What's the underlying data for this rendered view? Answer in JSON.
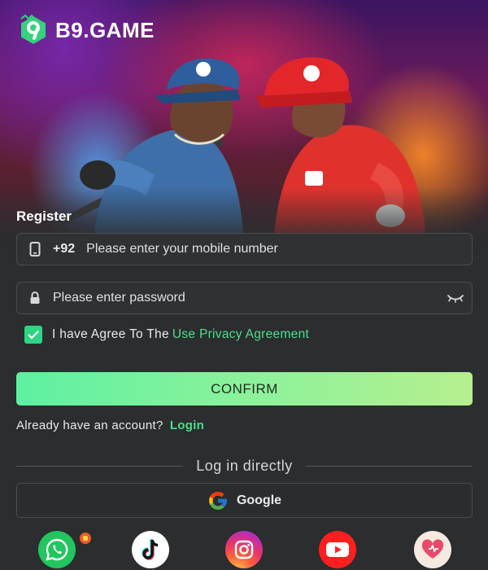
{
  "brand": {
    "name": "B9.GAME",
    "logo_icon": "b9-logo-icon",
    "accent": "#2ed585"
  },
  "register": {
    "title": "Register",
    "phone": {
      "country_code": "+92",
      "placeholder": "Please enter your mobile number",
      "value": ""
    },
    "password": {
      "placeholder": "Please enter password",
      "value": ""
    },
    "agree": {
      "checked": true,
      "text": "I have Agree To The",
      "link": "Use Privacy Agreement"
    },
    "confirm_label": "CONFIRM",
    "already": {
      "text": "Already have an account?",
      "link": "Login"
    }
  },
  "direct": {
    "divider": "Log in directly",
    "google_label": "Google",
    "socials": [
      {
        "name": "whatsapp",
        "icon": "whatsapp-icon"
      },
      {
        "name": "tiktok",
        "icon": "tiktok-icon"
      },
      {
        "name": "instagram",
        "icon": "instagram-icon"
      },
      {
        "name": "youtube",
        "icon": "youtube-icon"
      },
      {
        "name": "heart",
        "icon": "heart-icon"
      }
    ]
  }
}
